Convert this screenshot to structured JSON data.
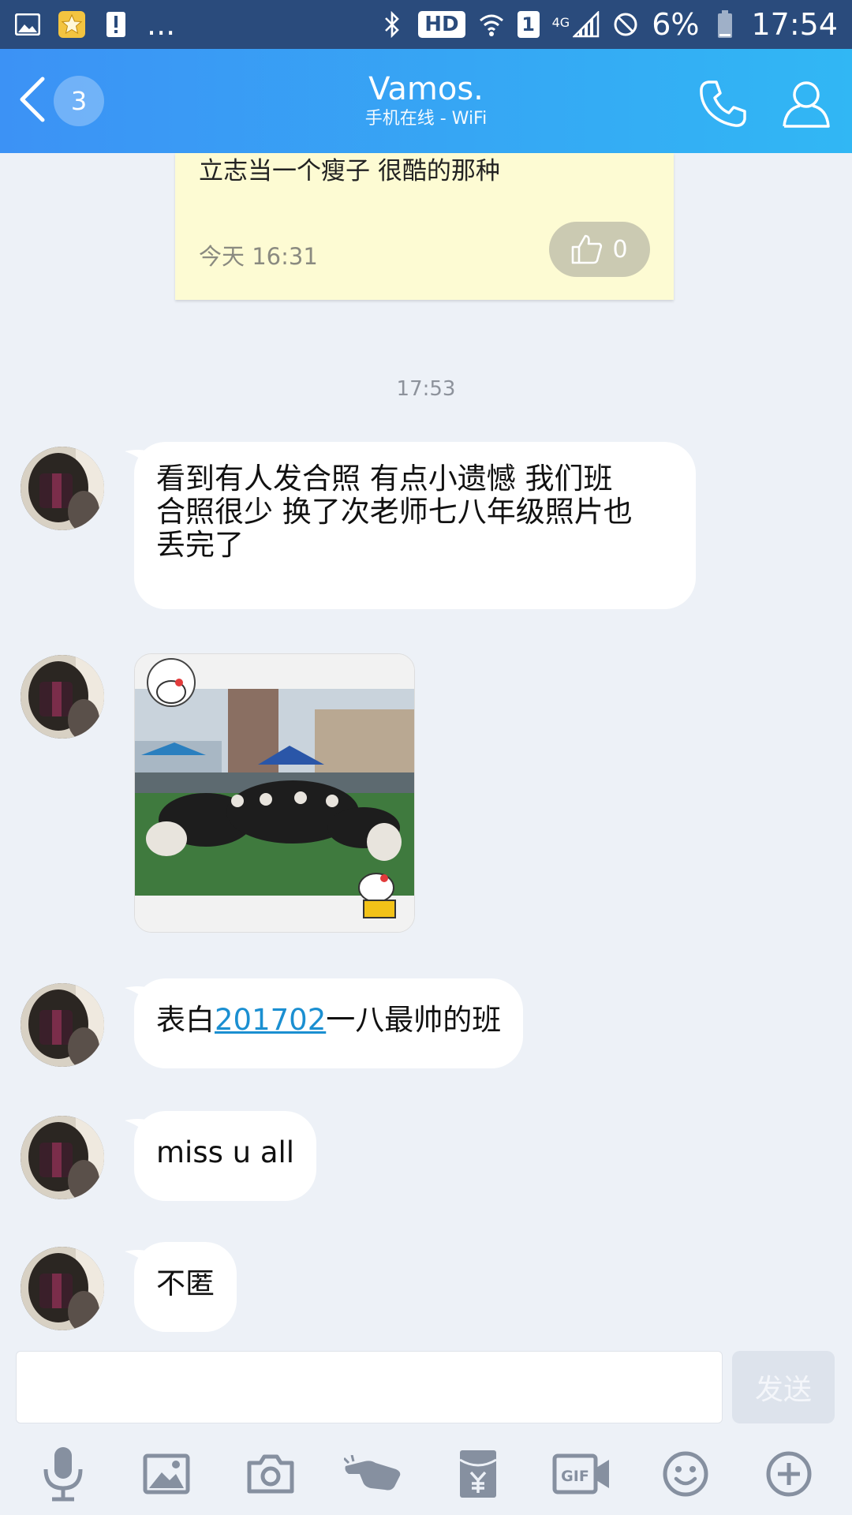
{
  "status_bar": {
    "ellipsis": "...",
    "hd": "HD",
    "sim": "1",
    "network": "4G",
    "battery": "6%",
    "time": "17:54"
  },
  "header": {
    "unread_count": "3",
    "title": "Vamos.",
    "subtitle": "手机在线 - WiFi"
  },
  "note": {
    "text": "立志当一个瘦子 很酷的那种",
    "time": "今天 16:31",
    "likes": "0"
  },
  "time_divider": "17:53",
  "messages": [
    {
      "type": "text",
      "lines": [
        "看到有人发合照 有点小遗憾 我们班",
        "合照很少 换了次老师七八年级照片也",
        "丢完了"
      ]
    },
    {
      "type": "image"
    },
    {
      "type": "text",
      "prefix": "表白",
      "link": "201702",
      "suffix": "一八最帅的班"
    },
    {
      "type": "text",
      "text": "miss u all"
    },
    {
      "type": "text",
      "text": "不匿"
    }
  ],
  "input": {
    "send_label": "发送"
  },
  "toolbar": {
    "icons": [
      "microphone-icon",
      "image-icon",
      "camera-icon",
      "poke-icon",
      "red-packet-icon",
      "gif-icon",
      "emoji-icon",
      "plus-icon"
    ],
    "gif_label": "GIF"
  },
  "colors": {
    "status_bar": "#2a4b7c",
    "header_start": "#3c92f5",
    "header_end": "#31b7f4",
    "background": "#edf1f7",
    "note_bg": "#fdfbd3",
    "link": "#1b8fd1"
  }
}
